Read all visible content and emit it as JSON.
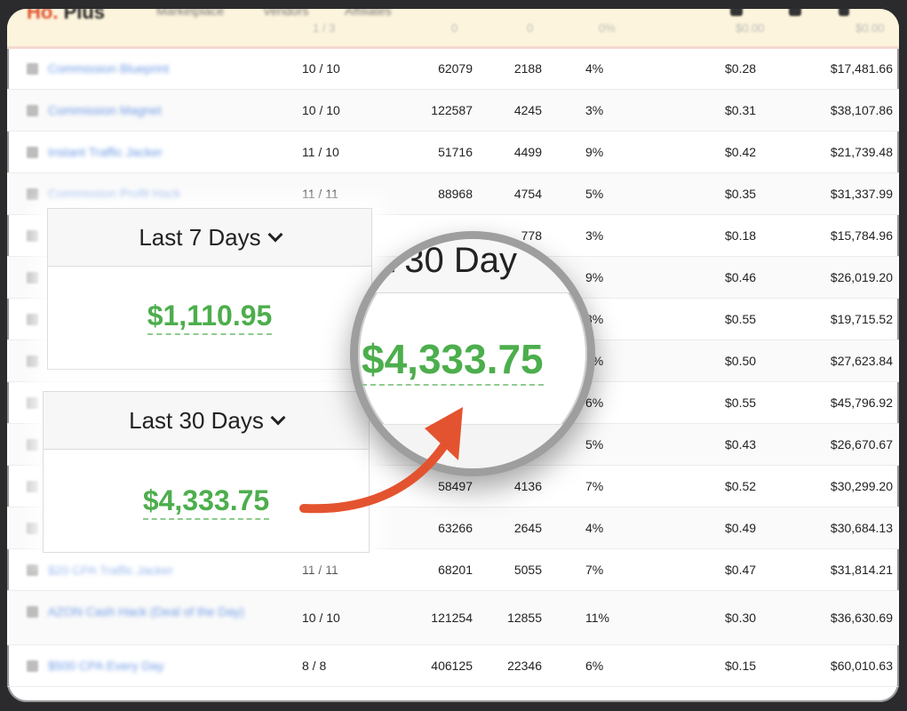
{
  "header": {
    "brand_prefix": "Ho.",
    "brand_suffix": "Plus",
    "nav": [
      "Marketplace",
      "Vendors",
      "Affiliates"
    ],
    "faded_row": [
      "1 / 3",
      "0",
      "0",
      "0%",
      "$0.00",
      "$0.00"
    ]
  },
  "rows": [
    {
      "name": "Commission Blueprint",
      "rank": "10 / 10",
      "clicks": "62079",
      "unique": "2188",
      "pct": "4%",
      "epc": "$0.28",
      "earn": "$17,481.66"
    },
    {
      "name": "Commission Magnet",
      "rank": "10 / 10",
      "clicks": "122587",
      "unique": "4245",
      "pct": "3%",
      "epc": "$0.31",
      "earn": "$38,107.86"
    },
    {
      "name": "Instant Traffic Jacker",
      "rank": "11 / 10",
      "clicks": "51716",
      "unique": "4499",
      "pct": "9%",
      "epc": "$0.42",
      "earn": "$21,739.48"
    },
    {
      "name": "Commission Profit Hack",
      "rank": "11 / 11",
      "clicks": "88968",
      "unique": "4754",
      "pct": "5%",
      "epc": "$0.35",
      "earn": "$31,337.99"
    },
    {
      "name": "",
      "rank": "",
      "clicks": "",
      "unique": "778",
      "pct": "3%",
      "epc": "$0.18",
      "earn": "$15,784.96"
    },
    {
      "name": "",
      "rank": "",
      "clicks": "",
      "unique": "",
      "pct": "9%",
      "epc": "$0.46",
      "earn": "$26,019.20"
    },
    {
      "name": "",
      "rank": "",
      "clicks": "",
      "unique": "",
      "pct": "8%",
      "epc": "$0.55",
      "earn": "$19,715.52"
    },
    {
      "name": "",
      "rank": "",
      "clicks": "",
      "unique": "",
      "pct": "6%",
      "epc": "$0.50",
      "earn": "$27,623.84"
    },
    {
      "name": "",
      "rank": "",
      "clicks": "",
      "unique": "",
      "pct": "6%",
      "epc": "$0.55",
      "earn": "$45,796.92"
    },
    {
      "name": "",
      "rank": "",
      "clicks": "",
      "unique": "",
      "pct": "5%",
      "epc": "$0.43",
      "earn": "$26,670.67"
    },
    {
      "name": "",
      "rank": "",
      "clicks": "58497",
      "unique": "4136",
      "pct": "7%",
      "epc": "$0.52",
      "earn": "$30,299.20"
    },
    {
      "name": "",
      "rank": "",
      "clicks": "63266",
      "unique": "2645",
      "pct": "4%",
      "epc": "$0.49",
      "earn": "$30,684.13"
    },
    {
      "name": "$20 CPA Traffic Jacker",
      "rank": "11 / 11",
      "clicks": "68201",
      "unique": "5055",
      "pct": "7%",
      "epc": "$0.47",
      "earn": "$31,814.21"
    },
    {
      "name": "AZON Cash Hack (Deal of the Day)",
      "rank": "10 / 10",
      "clicks": "121254",
      "unique": "12855",
      "pct": "11%",
      "epc": "$0.30",
      "earn": "$36,630.69"
    },
    {
      "name": "$500 CPA Every Day",
      "rank": "8 / 8",
      "clicks": "406125",
      "unique": "22346",
      "pct": "6%",
      "epc": "$0.15",
      "earn": "$60,010.63"
    }
  ],
  "cards": {
    "last7_label": "Last 7 Days",
    "last7_amount": "$1,110.95",
    "last30_label": "Last 30 Days",
    "last30_amount": "$4,333.75"
  },
  "magnifier": {
    "header_text": "t 30 Day",
    "amount": "$4,333.75"
  },
  "colors": {
    "amount_green": "#4cae4c",
    "arrow_orange": "#e4532f",
    "link_blue": "#6f9be6"
  },
  "icons": [
    "dropdown-chevron-icon",
    "curved-arrow-icon",
    "magnifier-lens"
  ]
}
